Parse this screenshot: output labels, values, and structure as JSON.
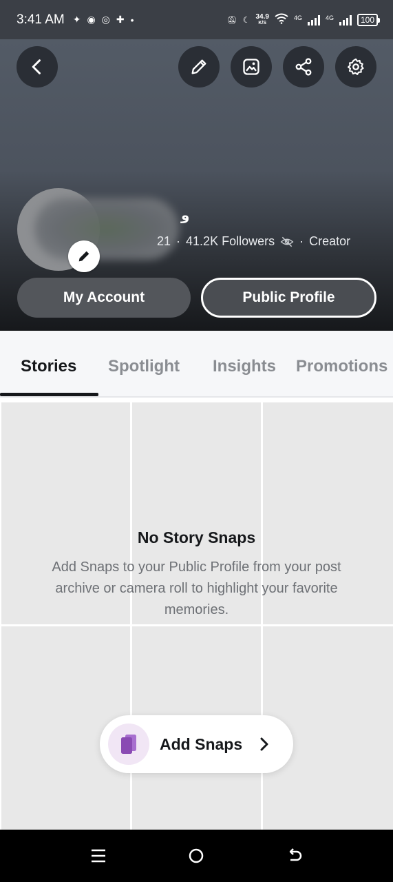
{
  "status_bar": {
    "time": "3:41 AM",
    "speed_value": "34.9",
    "speed_unit": "K/S",
    "network_1": "4G",
    "network_2": "4G",
    "battery": "100"
  },
  "header": {
    "name_glyph": "ﻭ",
    "count_fragment": "21",
    "followers": "41.2K Followers",
    "role": "Creator",
    "my_account_label": "My Account",
    "public_profile_label": "Public Profile"
  },
  "tabs": [
    {
      "label": "Stories",
      "active": true
    },
    {
      "label": "Spotlight",
      "active": false
    },
    {
      "label": "Insights",
      "active": false
    },
    {
      "label": "Promotions",
      "active": false
    }
  ],
  "empty_state": {
    "title": "No Story Snaps",
    "body": "Add Snaps to your Public Profile from your post archive or camera roll to highlight your favorite memories."
  },
  "add_snaps": {
    "label": "Add Snaps"
  },
  "colors": {
    "accent_purple": "#8a4bb3",
    "dark": "#16181b"
  }
}
